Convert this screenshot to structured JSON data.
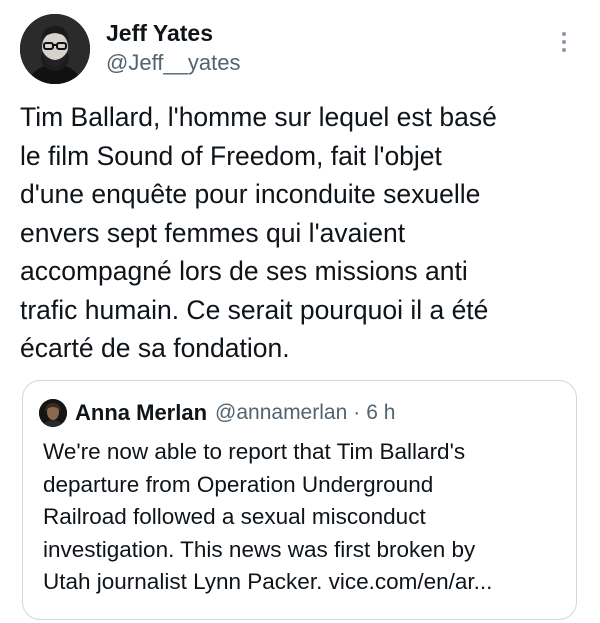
{
  "author": {
    "display_name": "Jeff Yates",
    "handle": "@Jeff__yates"
  },
  "tweet": {
    "text": "Tim Ballard, l'homme sur lequel est basé\nle film Sound of Freedom, fait l'objet\nd'une enquête pour inconduite sexuelle\nenvers sept femmes qui l'avaient\naccompagné lors de ses missions anti\ntrafic humain. Ce serait pourquoi il a été\nécarté de sa fondation."
  },
  "quoted_tweet": {
    "display_name": "Anna Merlan",
    "handle": "@annamerlan",
    "separator": "·",
    "time": "6 h",
    "text": "We're now able to report that Tim Ballard's\ndeparture from Operation Underground\nRailroad followed a sexual misconduct\ninvestigation. This news was first broken by\nUtah journalist Lynn Packer. vice.com/en/ar..."
  },
  "icons": {
    "more": "more-vertical-icon",
    "avatar": "author-avatar",
    "quote_avatar": "quoted-author-avatar"
  },
  "colors": {
    "text": "#0f1419",
    "secondary": "#536471",
    "border": "#cfd9de"
  }
}
